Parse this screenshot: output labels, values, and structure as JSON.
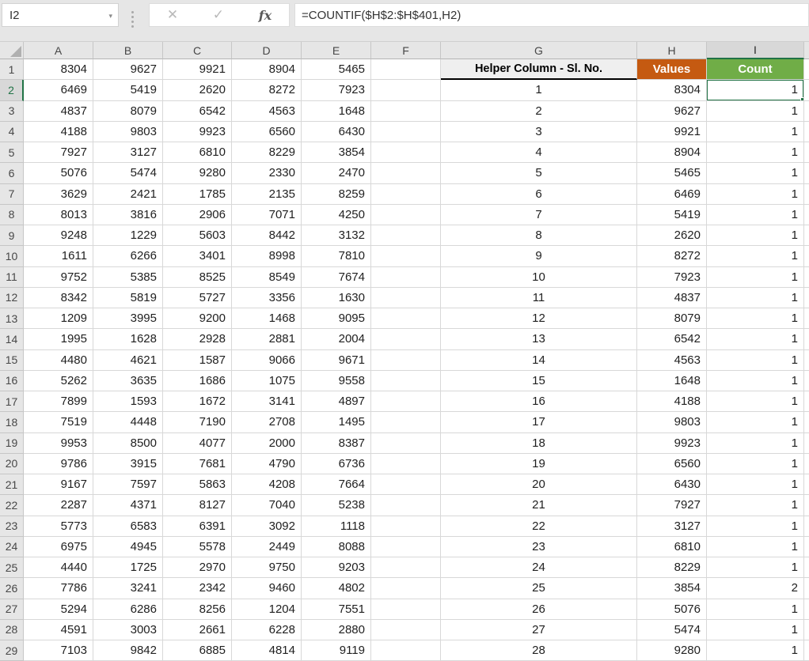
{
  "formula_bar": {
    "name_box_value": "I2",
    "dropdown_icon": "▾",
    "cancel_label": "✕",
    "enter_label": "✓",
    "fx_label": "fx",
    "formula": "=COUNTIF($H$2:$H$401,H2)"
  },
  "grid": {
    "column_letters": [
      "A",
      "B",
      "C",
      "D",
      "E",
      "F",
      "G",
      "H",
      "I"
    ],
    "row_count": 29,
    "selected": {
      "cell": "I2",
      "row": 2,
      "col": "I"
    },
    "header_row": {
      "g": "Helper Column - Sl. No.",
      "h": "Values",
      "i": "Count"
    },
    "main_data": [
      [
        8304,
        9627,
        9921,
        8904,
        5465
      ],
      [
        6469,
        5419,
        2620,
        8272,
        7923
      ],
      [
        4837,
        8079,
        6542,
        4563,
        1648
      ],
      [
        4188,
        9803,
        9923,
        6560,
        6430
      ],
      [
        7927,
        3127,
        6810,
        8229,
        3854
      ],
      [
        5076,
        5474,
        9280,
        2330,
        2470
      ],
      [
        3629,
        2421,
        1785,
        2135,
        8259
      ],
      [
        8013,
        3816,
        2906,
        7071,
        4250
      ],
      [
        9248,
        1229,
        5603,
        8442,
        3132
      ],
      [
        1611,
        6266,
        3401,
        8998,
        7810
      ],
      [
        9752,
        5385,
        8525,
        8549,
        7674
      ],
      [
        8342,
        5819,
        5727,
        3356,
        1630
      ],
      [
        1209,
        3995,
        9200,
        1468,
        9095
      ],
      [
        1995,
        1628,
        2928,
        2881,
        2004
      ],
      [
        4480,
        4621,
        1587,
        9066,
        9671
      ],
      [
        5262,
        3635,
        1686,
        1075,
        9558
      ],
      [
        7899,
        1593,
        1672,
        3141,
        4897
      ],
      [
        7519,
        4448,
        7190,
        2708,
        1495
      ],
      [
        9953,
        8500,
        4077,
        2000,
        8387
      ],
      [
        9786,
        3915,
        7681,
        4790,
        6736
      ],
      [
        9167,
        7597,
        5863,
        4208,
        7664
      ],
      [
        2287,
        4371,
        8127,
        7040,
        5238
      ],
      [
        5773,
        6583,
        6391,
        3092,
        1118
      ],
      [
        6975,
        4945,
        5578,
        2449,
        8088
      ],
      [
        4440,
        1725,
        2970,
        9750,
        9203
      ],
      [
        7786,
        3241,
        2342,
        9460,
        4802
      ],
      [
        5294,
        6286,
        8256,
        1204,
        7551
      ],
      [
        4591,
        3003,
        2661,
        6228,
        2880
      ],
      [
        7103,
        9842,
        6885,
        4814,
        9119
      ]
    ],
    "helper_sl": [
      1,
      2,
      3,
      4,
      5,
      6,
      7,
      8,
      9,
      10,
      11,
      12,
      13,
      14,
      15,
      16,
      17,
      18,
      19,
      20,
      21,
      22,
      23,
      24,
      25,
      26,
      27,
      28
    ],
    "helper_values": [
      8304,
      9627,
      9921,
      8904,
      5465,
      6469,
      5419,
      2620,
      8272,
      7923,
      4837,
      8079,
      6542,
      4563,
      1648,
      4188,
      9803,
      9923,
      6560,
      6430,
      7927,
      3127,
      6810,
      8229,
      3854,
      5076,
      5474,
      9280
    ],
    "helper_counts": [
      1,
      1,
      1,
      1,
      1,
      1,
      1,
      1,
      1,
      1,
      1,
      1,
      1,
      1,
      1,
      1,
      1,
      1,
      1,
      1,
      1,
      1,
      1,
      1,
      2,
      1,
      1,
      1
    ]
  },
  "colors": {
    "values_header_bg": "#C55A11",
    "count_header_bg": "#70AD47",
    "selection_green": "#217346",
    "helper_header_bg": "#EFEFEF"
  }
}
